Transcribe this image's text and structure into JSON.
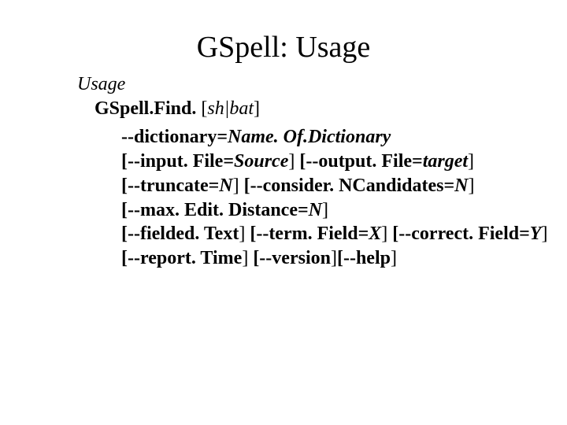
{
  "title": "GSpell: Usage",
  "usage_label": "Usage",
  "command_name": "GSpell.Find.",
  "command_ext_open": " [",
  "command_ext": "sh|bat",
  "command_ext_close": "]",
  "opts": {
    "l1": {
      "dash": "--",
      "key": "dictionary=",
      "val": "Name. Of.Dictionary"
    },
    "l2": {
      "o1": "[--",
      "k1": "input. File=",
      "v1": "Source",
      "c1": "]",
      "o2": "[--",
      "k2": "output. File=",
      "v2": "target",
      "c2": "]"
    },
    "l3": {
      "o1": "[--",
      "k1": "truncate=",
      "v1": "N",
      "c1": "]",
      "o2": "[--",
      "k2": "consider. NCandidates=",
      "v2": "N",
      "c2": "]"
    },
    "l4": {
      "o1": "[--",
      "k1": "max. Edit. Distance=",
      "v1": "N",
      "c1": "]"
    },
    "l5": {
      "o1": "[--",
      "k1": "fielded. Text",
      "c1": "]",
      "o2": "[--",
      "k2": "term. Field=",
      "v2": "X",
      "c2": "]",
      "o3": "[--",
      "k3": "correct. Field=",
      "v3": "Y",
      "c3": "]"
    },
    "l6": {
      "o1": "[--",
      "k1": "report. Time",
      "c1": "]",
      "o2": "[--",
      "k2": "version",
      "c2": "]",
      "o3": "[--",
      "k3": "help",
      "c3": "]"
    }
  }
}
